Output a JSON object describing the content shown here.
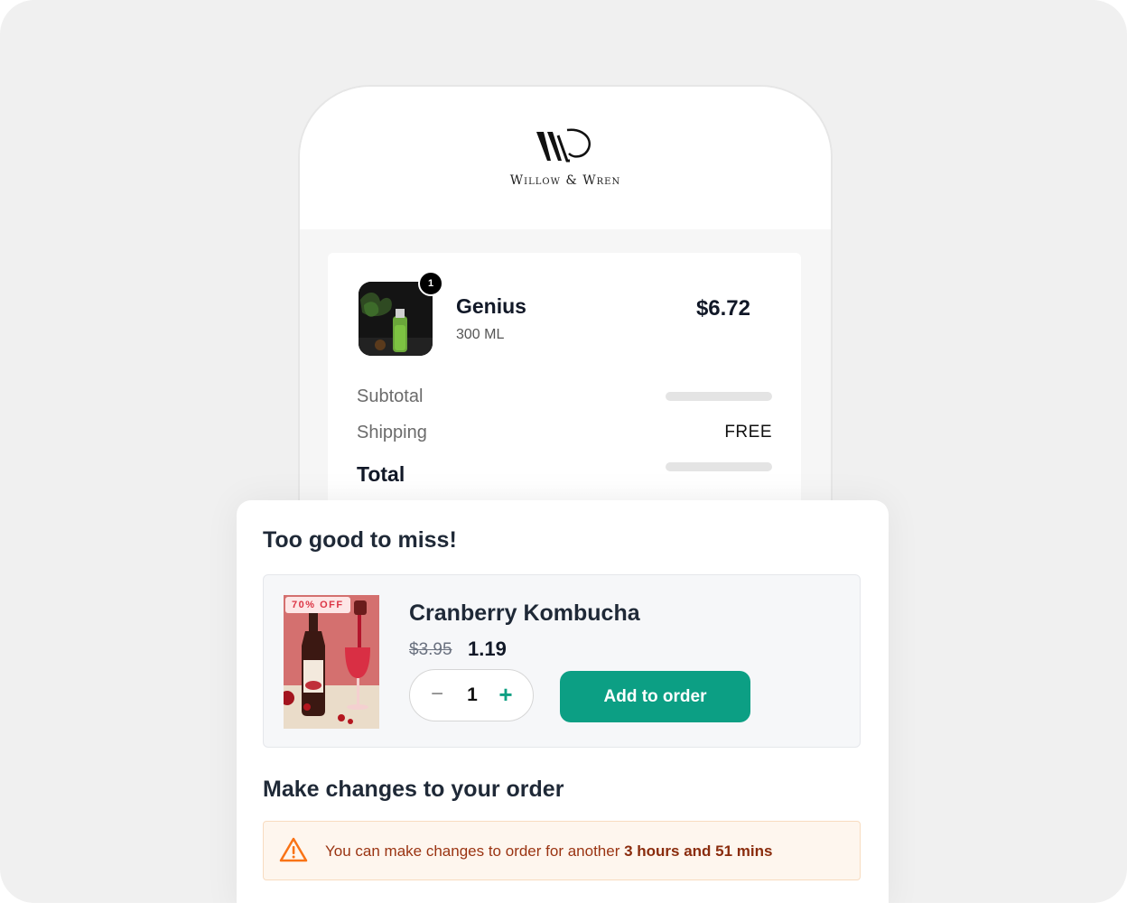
{
  "brand": {
    "name": "Willow & Wren",
    "logo": "WW-monogram"
  },
  "cart": {
    "item": {
      "name": "Genius",
      "volume": "300 ML",
      "price": "$6.72",
      "quantity_badge": "1"
    },
    "subtotal_label": "Subtotal",
    "shipping_label": "Shipping",
    "shipping_value": "FREE",
    "total_label": "Total"
  },
  "upsell": {
    "title": "Too good to miss!",
    "badge": "70% OFF",
    "product_name": "Cranberry Kombucha",
    "old_price": "$3.95",
    "new_price": "1.19",
    "quantity": "1",
    "minus_symbol": "−",
    "plus_symbol": "+",
    "add_label": "Add to order"
  },
  "changes": {
    "title": "Make changes to your order",
    "notice_prefix": "You can make changes to order for another ",
    "notice_time": "3 hours and 51 mins",
    "icon": "warning-triangle-icon"
  },
  "colors": {
    "accent": "#0c9f84",
    "warning": "#f97316",
    "warning_bg": "#fef6ee",
    "sale": "#dc3545"
  }
}
